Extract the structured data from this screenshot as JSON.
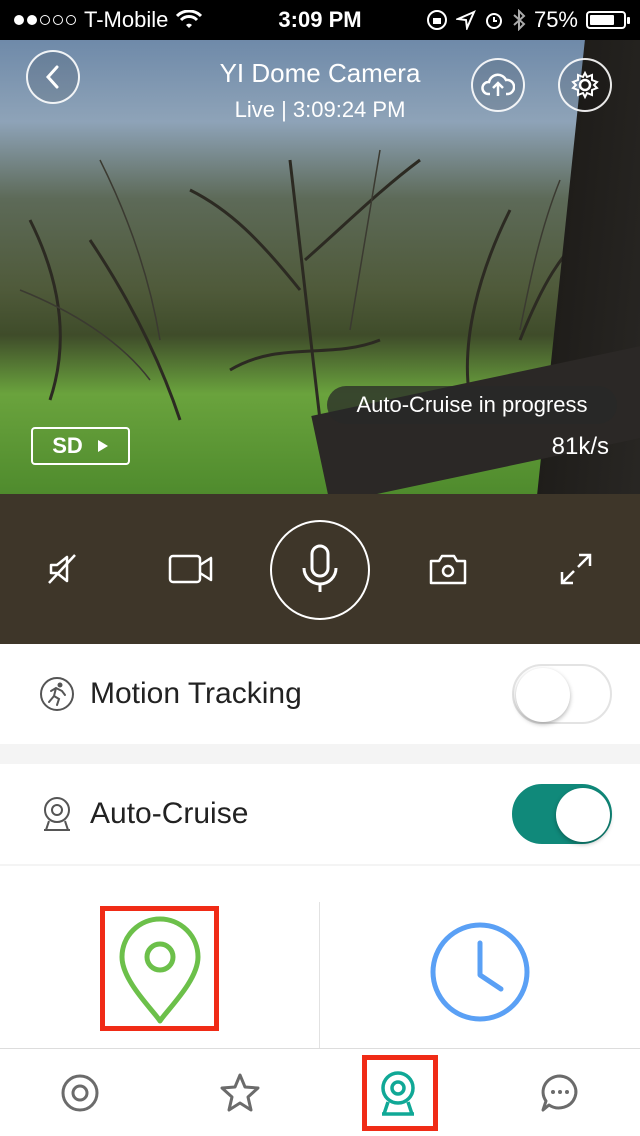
{
  "status_bar": {
    "carrier": "T-Mobile",
    "time": "3:09 PM",
    "battery": "75%",
    "battery_level": 0.75,
    "signal_bars_filled": 2,
    "signal_bars_total": 5
  },
  "camera": {
    "title": "YI Dome Camera",
    "subtitle": "Live | 3:09:24 PM",
    "cruise_status": "Auto-Cruise in progress",
    "sd_label": "SD",
    "speed": "81k/s"
  },
  "controls": {
    "items": [
      "mute-icon",
      "record-video-icon",
      "microphone-icon",
      "snapshot-icon",
      "fullscreen-icon"
    ]
  },
  "settings": {
    "motion_tracking": {
      "label": "Motion Tracking",
      "enabled": false
    },
    "auto_cruise": {
      "label": "Auto-Cruise",
      "enabled": true
    }
  },
  "cruise_modes": {
    "items": [
      "location-pin-icon",
      "clock-icon"
    ],
    "location_color": "#6cc04a",
    "clock_color": "#5aa0f5"
  },
  "tab_bar": {
    "items": [
      "home-tab-icon",
      "favorites-tab-icon",
      "camera-tab-icon",
      "messages-tab-icon"
    ],
    "active": "camera-tab-icon",
    "active_color": "#10a896"
  },
  "colors": {
    "highlight": "#f02b16",
    "toggle_on": "#10897a",
    "controls_bg": "#3e3629"
  }
}
